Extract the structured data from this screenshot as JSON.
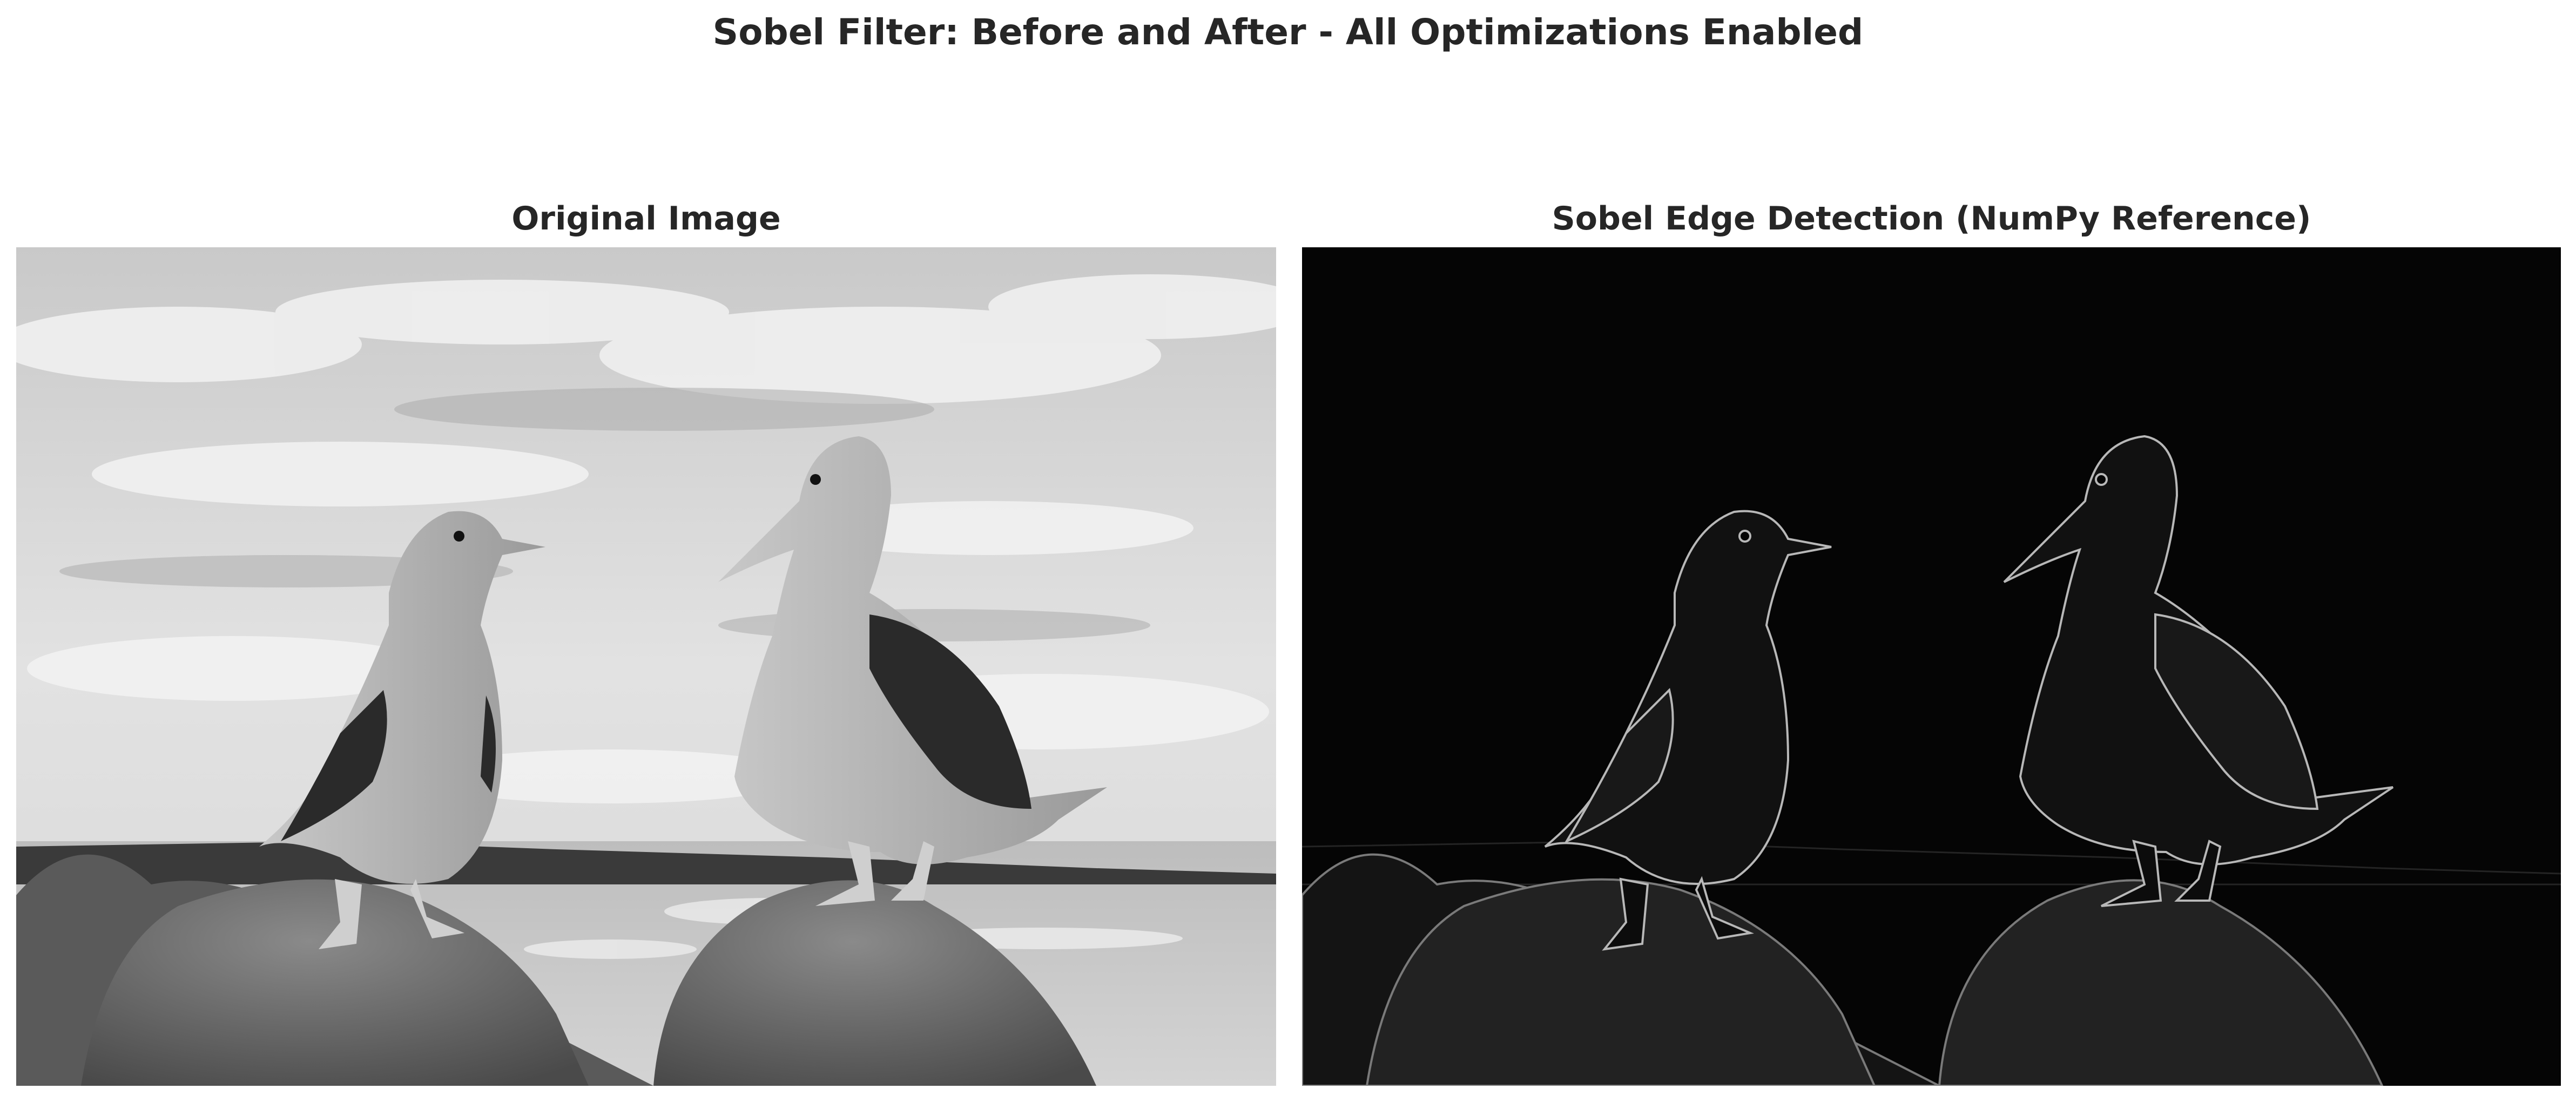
{
  "figure": {
    "title": "Sobel Filter: Before and After - All Optimizations Enabled"
  },
  "panels": [
    {
      "title": "Original Image",
      "image": "grayscale photo of two blue-footed boobies standing on rocks by the sea"
    },
    {
      "title": "Sobel Edge Detection (NumPy Reference)",
      "image": "sobel edge map of the same photo, light edges on black"
    }
  ],
  "colors": {
    "background": "#ffffff",
    "text": "#262626",
    "edge_background": "#050505"
  }
}
